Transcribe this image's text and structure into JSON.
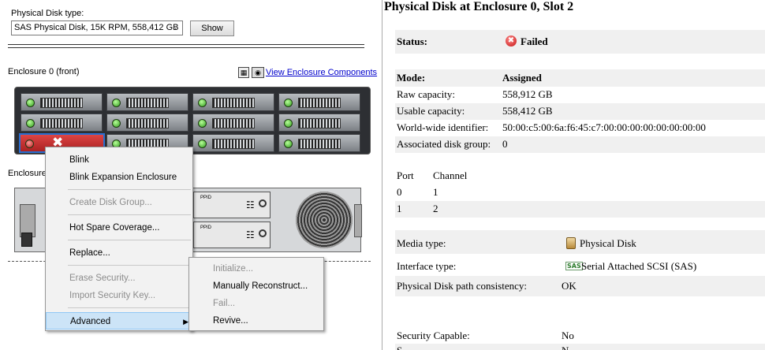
{
  "left": {
    "disk_type_label": "Physical Disk type:",
    "disk_type_value": "SAS Physical Disk, 15K RPM, 558,412 GB",
    "show_button": "Show",
    "enclosure0_label": "Enclosure 0 (front)",
    "enclosure_partial_label": "Enclosure",
    "view_components_link": "View Enclosure Components",
    "ppid_label": "PPID"
  },
  "context_menu": {
    "items": [
      {
        "label": "Blink",
        "enabled": true
      },
      {
        "label": "Blink Expansion Enclosure",
        "enabled": true
      },
      {
        "label": "Create Disk Group...",
        "enabled": false
      },
      {
        "label": "Hot Spare Coverage...",
        "enabled": true
      },
      {
        "label": "Replace...",
        "enabled": true
      },
      {
        "label": "Erase Security...",
        "enabled": false
      },
      {
        "label": "Import Security Key...",
        "enabled": false
      },
      {
        "label": "Advanced",
        "enabled": true,
        "highlighted": true
      }
    ]
  },
  "submenu": {
    "items": [
      {
        "label": "Initialize...",
        "enabled": false
      },
      {
        "label": "Manually Reconstruct...",
        "enabled": true
      },
      {
        "label": "Fail...",
        "enabled": false
      },
      {
        "label": "Revive...",
        "enabled": true
      }
    ]
  },
  "right": {
    "title": "Physical Disk at Enclosure 0, Slot 2",
    "status_label": "Status:",
    "status_value": "Failed",
    "mode_label": "Mode:",
    "mode_value": "Assigned",
    "raw_label": "Raw capacity:",
    "raw_value": "558,912 GB",
    "usable_label": "Usable capacity:",
    "usable_value": "558,412 GB",
    "wwid_label": "World-wide identifier:",
    "wwid_value": "50:00:c5:00:6a:f6:45:c7:00:00:00:00:00:00:00:00",
    "assoc_label": "Associated disk group:",
    "assoc_value": "0",
    "port_header": "Port",
    "channel_header": "Channel",
    "ports": [
      {
        "port": "0",
        "channel": "1"
      },
      {
        "port": "1",
        "channel": "2"
      }
    ],
    "media_label": "Media type:",
    "media_value": "Physical Disk",
    "interface_label": "Interface type:",
    "interface_icon_text": "SAS",
    "interface_value": "Serial Attached SCSI (SAS)",
    "path_label": "Physical Disk path consistency:",
    "path_value": "OK",
    "security_label": "Security Capable:",
    "security_value": "No",
    "partial_label": "S",
    "partial_value": "N"
  },
  "colors": {
    "failed": "#c41212",
    "menu_highlight": "#cce4f7",
    "link": "#0000cc"
  }
}
